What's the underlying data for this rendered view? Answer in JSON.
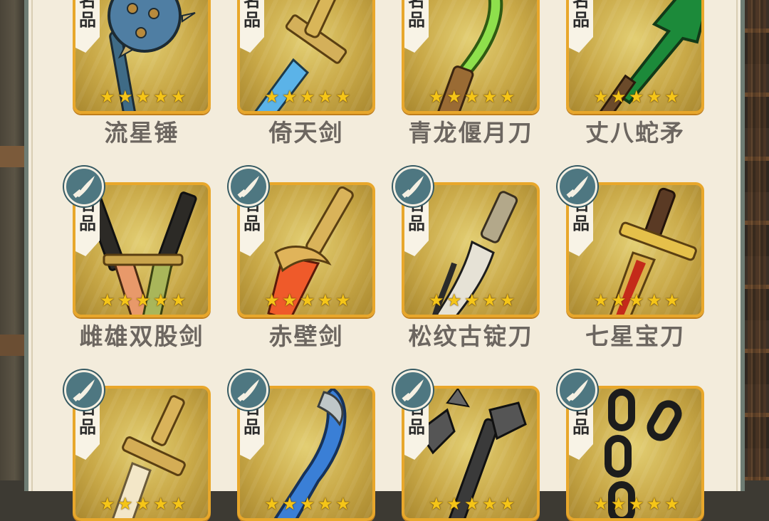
{
  "rank_label_top": "名",
  "rank_label_bottom": "品",
  "star_glyph": "★",
  "colors": {
    "frame": "#e8a72b",
    "badge": "#4e7781",
    "star": "#f5c518",
    "name": "#6c6660"
  },
  "weapons": [
    {
      "name": "流星锤",
      "rank": "名品",
      "stars": 5,
      "icon": "meteor-hammer-icon"
    },
    {
      "name": "倚天剑",
      "rank": "名品",
      "stars": 5,
      "icon": "yitian-sword-icon"
    },
    {
      "name": "青龙偃月刀",
      "rank": "名品",
      "stars": 5,
      "icon": "green-dragon-blade-icon"
    },
    {
      "name": "丈八蛇矛",
      "rank": "名品",
      "stars": 5,
      "icon": "serpent-spear-icon"
    },
    {
      "name": "雌雄双股剑",
      "rank": "名品",
      "stars": 5,
      "icon": "twin-swords-icon"
    },
    {
      "name": "赤壁剑",
      "rank": "名品",
      "stars": 5,
      "icon": "red-cliff-sword-icon"
    },
    {
      "name": "松纹古锭刀",
      "rank": "名品",
      "stars": 5,
      "icon": "pine-pattern-saber-icon"
    },
    {
      "name": "七星宝刀",
      "rank": "名品",
      "stars": 5,
      "icon": "seven-star-saber-icon"
    },
    {
      "name": "",
      "rank": "名品",
      "stars": 5,
      "icon": "golden-sword-icon"
    },
    {
      "name": "",
      "rank": "名品",
      "stars": 5,
      "icon": "blue-blade-icon"
    },
    {
      "name": "",
      "rank": "名品",
      "stars": 5,
      "icon": "spiked-trident-icon"
    },
    {
      "name": "",
      "rank": "名品",
      "stars": 5,
      "icon": "iron-chain-icon"
    }
  ]
}
